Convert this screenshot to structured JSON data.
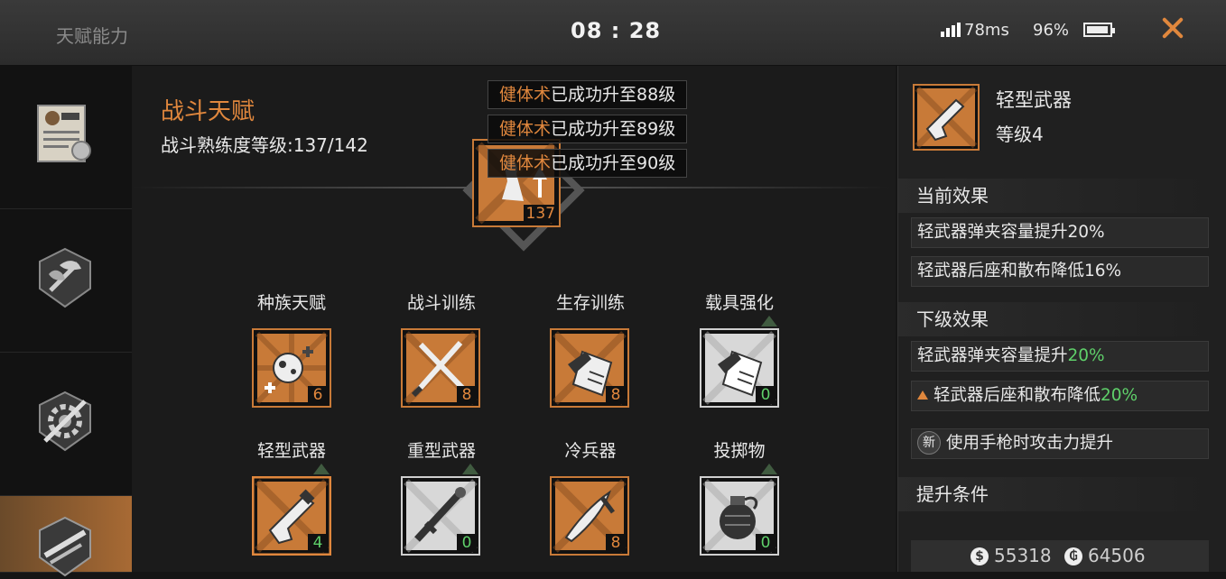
{
  "header": {
    "title": "天赋能力",
    "clock": "08 : 28",
    "ping": "78ms",
    "battery": "96%",
    "battery_level": 0.96
  },
  "nav": {
    "items": [
      {
        "icon": "trade-certificate-icon"
      },
      {
        "icon": "plant-emblem-icon"
      },
      {
        "icon": "gear-tools-icon"
      },
      {
        "icon": "weapons-icon"
      }
    ],
    "active_index": 3
  },
  "main": {
    "title": "战斗天赋",
    "proficiency": "战斗熟练度等级:137/142",
    "badge_level": "137",
    "toast_messages": [
      {
        "highlight": "健体术",
        "text": "已成功升至88级"
      },
      {
        "highlight": "健体术",
        "text": "已成功升至89级"
      },
      {
        "highlight": "健体术",
        "text": "已成功升至90级"
      }
    ],
    "skills": [
      {
        "label": "种族天赋",
        "level": "6",
        "style": "orange",
        "icon": "virus-plus-icon"
      },
      {
        "label": "战斗训练",
        "level": "8",
        "style": "orange",
        "icon": "crossed-blades-icon"
      },
      {
        "label": "生存训练",
        "level": "8",
        "style": "orange",
        "icon": "survival-book-icon"
      },
      {
        "label": "载具强化",
        "level": "0",
        "style": "white",
        "icon": "vehicle-book-icon"
      },
      {
        "label": "轻型武器",
        "level": "4",
        "style": "orange",
        "icon": "pistol-icon"
      },
      {
        "label": "重型武器",
        "level": "0",
        "style": "white",
        "icon": "rifle-icon"
      },
      {
        "label": "冷兵器",
        "level": "8",
        "style": "orange",
        "icon": "knife-icon"
      },
      {
        "label": "投掷物",
        "level": "0",
        "style": "white",
        "icon": "grenade-icon"
      }
    ]
  },
  "detail": {
    "name": "轻型武器",
    "level": "等级4",
    "current_title": "当前效果",
    "current_effects": [
      "轻武器弹夹容量提升20%",
      "轻武器后座和散布降低16%"
    ],
    "next_title": "下级效果",
    "next_effects": [
      {
        "prefix": "轻武器弹夹容量提升",
        "value": "20%",
        "icon": ""
      },
      {
        "prefix": "轻武器后座和散布降低",
        "value": "20%",
        "icon": "up-arrow-icon"
      },
      {
        "prefix": "使用手枪时攻击力提升",
        "value": "",
        "icon": "new-badge-icon",
        "badge": "新"
      }
    ],
    "upgrade_title": "提升条件",
    "currency_silver": "55318",
    "currency_gold": "64506"
  },
  "colors": {
    "accent": "#e0873d",
    "green": "#5fd06a",
    "bg": "#151515"
  }
}
